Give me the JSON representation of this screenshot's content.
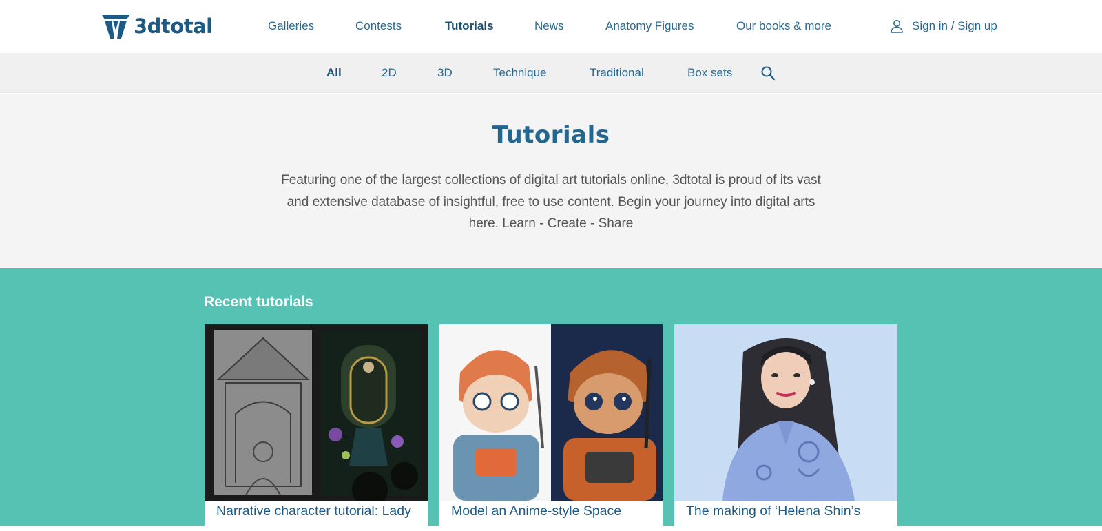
{
  "brand": {
    "name": "3dtotal"
  },
  "nav": {
    "items": [
      {
        "label": "Galleries",
        "active": false
      },
      {
        "label": "Contests",
        "active": false
      },
      {
        "label": "Tutorials",
        "active": true
      },
      {
        "label": "News",
        "active": false
      },
      {
        "label": "Anatomy Figures",
        "active": false
      },
      {
        "label": "Our books & more",
        "active": false
      }
    ],
    "signin_label": "Sign in / Sign up"
  },
  "subnav": {
    "items": [
      {
        "label": "All",
        "active": true
      },
      {
        "label": "2D",
        "active": false
      },
      {
        "label": "3D",
        "active": false
      },
      {
        "label": "Technique",
        "active": false
      },
      {
        "label": "Traditional",
        "active": false
      },
      {
        "label": "Box sets",
        "active": false
      }
    ],
    "search_icon": "search-icon"
  },
  "hero": {
    "title": "Tutorials",
    "description": "Featuring one of the largest collections of digital art tutorials online, 3dtotal is proud of its vast and extensive database of insightful, free to use content. Begin your journey into digital arts here. Learn - Create - Share"
  },
  "recent": {
    "heading": "Recent tutorials",
    "cards": [
      {
        "title": "Narrative character tutorial: Lady"
      },
      {
        "title": "Model an Anime-style Space"
      },
      {
        "title": "The making of ‘Helena Shin’s"
      }
    ]
  },
  "colors": {
    "brand_blue": "#1d5a86",
    "link_blue": "#2b6a90",
    "hero_bg": "#f4f4f4",
    "subnav_bg": "#f0f0f0",
    "teal_section": "#56c2b3"
  }
}
